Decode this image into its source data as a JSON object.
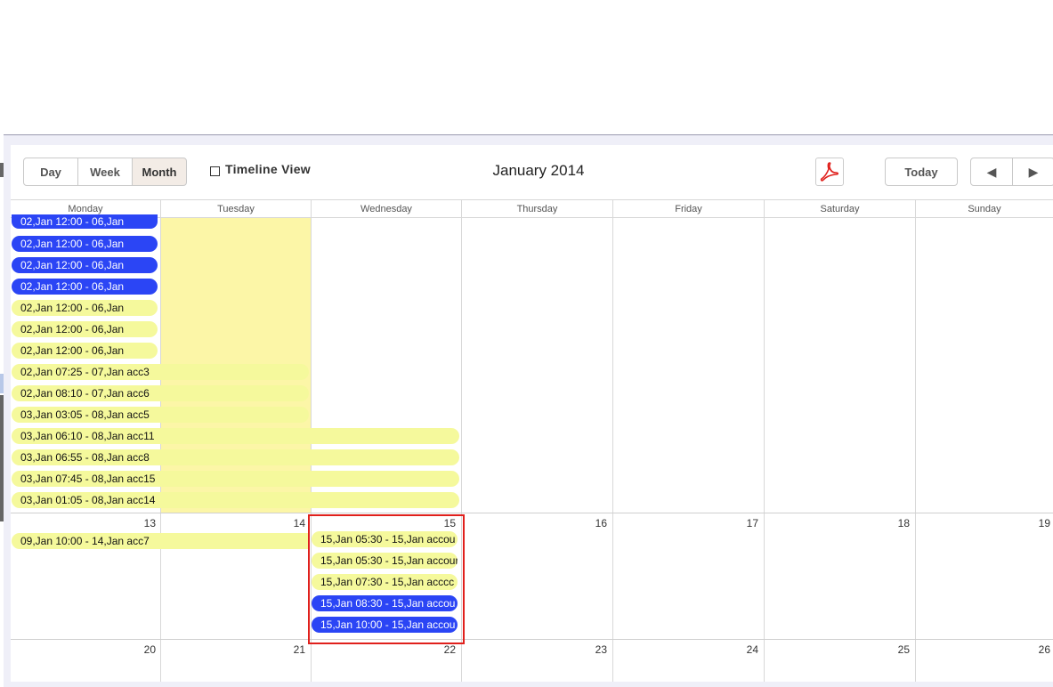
{
  "toolbar": {
    "day_label": "Day",
    "week_label": "Week",
    "month_label": "Month",
    "timeline_label": "Timeline View",
    "title": "January 2014",
    "today_label": "Today",
    "prev_icon": "◀",
    "next_icon": "▶"
  },
  "weekdays": [
    "Monday",
    "Tuesday",
    "Wednesday",
    "Thursday",
    "Friday",
    "Saturday",
    "Sunday"
  ],
  "weeks": [
    {
      "days": [
        "",
        "",
        "",
        "",
        "",
        "",
        ""
      ]
    },
    {
      "days": [
        "13",
        "14",
        "15",
        "16",
        "17",
        "18",
        "19"
      ]
    },
    {
      "days": [
        "20",
        "21",
        "22",
        "23",
        "24",
        "25",
        "26"
      ]
    }
  ],
  "events": {
    "week1": [
      {
        "text": "02,Jan 12:00 - 06,Jan",
        "style": "blue"
      },
      {
        "text": "02,Jan 12:00 - 06,Jan",
        "style": "blue"
      },
      {
        "text": "02,Jan 12:00 - 06,Jan",
        "style": "blue"
      },
      {
        "text": "02,Jan 12:00 - 06,Jan",
        "style": "blue"
      },
      {
        "text": "02,Jan 12:00 - 06,Jan",
        "style": "yellow"
      },
      {
        "text": "02,Jan 12:00 - 06,Jan",
        "style": "yellow"
      },
      {
        "text": "02,Jan 12:00 - 06,Jan",
        "style": "yellow"
      },
      {
        "text": "02,Jan 07:25 - 07,Jan acc3",
        "style": "yellow"
      },
      {
        "text": "02,Jan 08:10 - 07,Jan acc6",
        "style": "yellow"
      },
      {
        "text": "03,Jan 03:05 - 08,Jan acc5",
        "style": "yellow"
      },
      {
        "text": "03,Jan 06:10 - 08,Jan acc11",
        "style": "yellow"
      },
      {
        "text": "03,Jan 06:55 - 08,Jan acc8",
        "style": "yellow"
      },
      {
        "text": "03,Jan 07:45 - 08,Jan acc15",
        "style": "yellow"
      },
      {
        "text": "03,Jan 01:05 - 08,Jan acc14",
        "style": "yellow"
      }
    ],
    "week2_monday": [
      {
        "text": "09,Jan 10:00 - 14,Jan acc7",
        "style": "yellow"
      }
    ],
    "week2_wednesday": [
      {
        "text": "15,Jan 05:30 - 15,Jan accou",
        "style": "yellow"
      },
      {
        "text": "15,Jan 05:30 - 15,Jan accour",
        "style": "yellow"
      },
      {
        "text": "15,Jan 07:30 - 15,Jan acccc",
        "style": "yellow"
      },
      {
        "text": "15,Jan 08:30 - 15,Jan accou",
        "style": "blue"
      },
      {
        "text": "15,Jan 10:00 - 15,Jan accou",
        "style": "blue"
      }
    ]
  },
  "colors": {
    "event_blue": "#2b45f5",
    "event_yellow": "#f5f99c",
    "highlight_box": "#e0201c",
    "pdf_icon": "#e0201c"
  },
  "icons": {
    "pdf": "pdf-icon",
    "prev": "triangle-left-icon",
    "next": "triangle-right-icon"
  }
}
